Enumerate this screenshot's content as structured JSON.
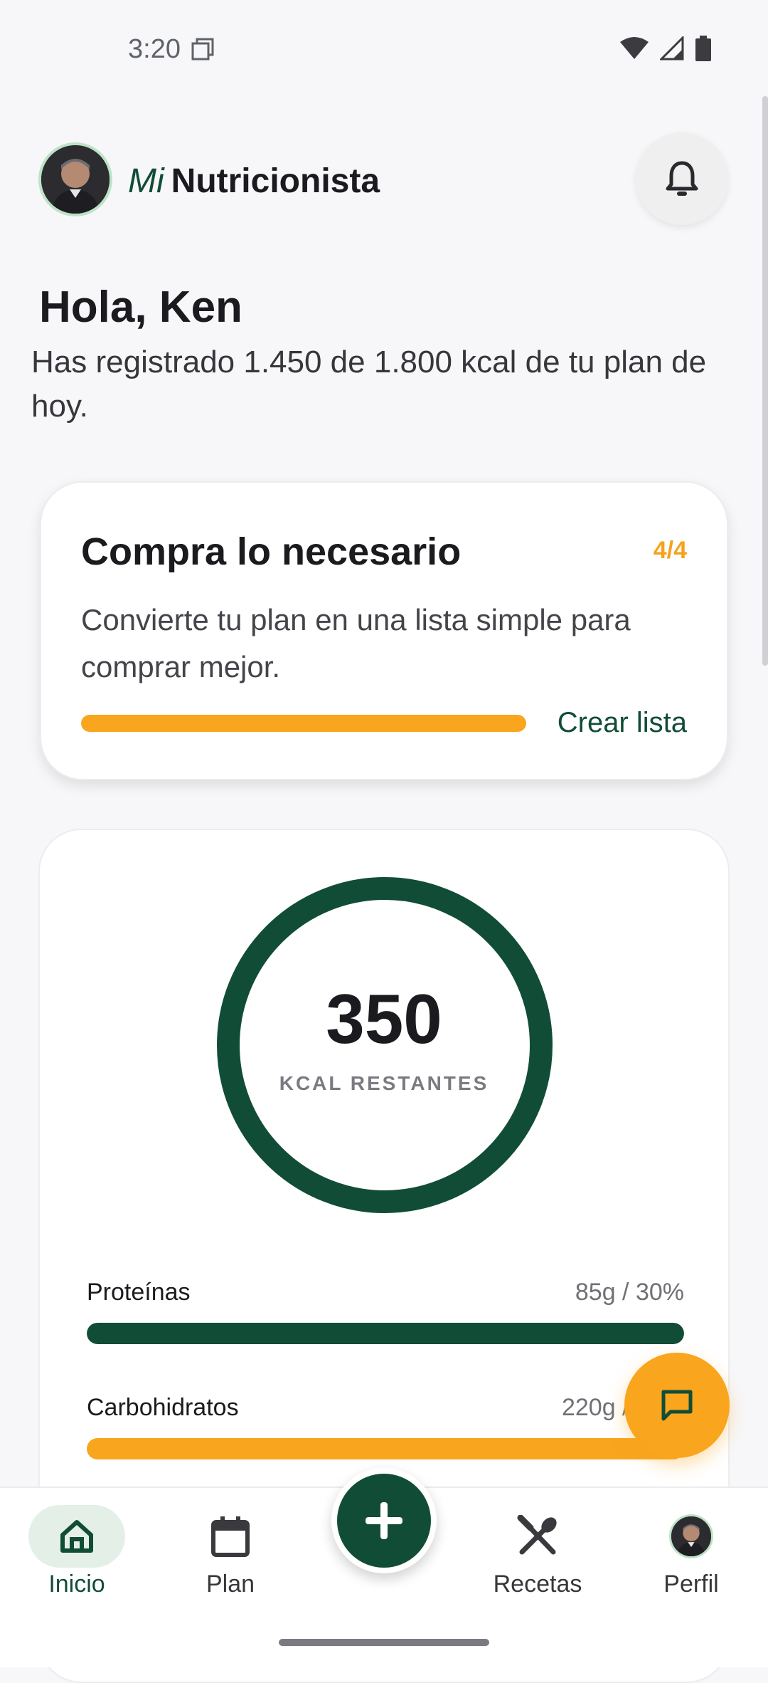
{
  "status_bar": {
    "time": "3:20"
  },
  "header": {
    "brand_prefix": "Mi",
    "brand_name": "Nutricionista"
  },
  "greeting": {
    "title": "Hola, Ken",
    "summary": "Has registrado 1.450 de 1.800 kcal de tu plan de hoy."
  },
  "shopping_card": {
    "title": "Compra lo necesario",
    "step": "4/4",
    "description": "Convierte tu plan en una lista simple para comprar mejor.",
    "progress_fraction": 1.0,
    "link_label": "Crear lista"
  },
  "calories_card": {
    "value": "350",
    "label": "KCAL RESTANTES",
    "macros": [
      {
        "name": "Proteínas",
        "value": "85g / 30%",
        "fill_fraction": 1.0,
        "color": "#114d36"
      },
      {
        "name": "Carbohidratos",
        "value": "220g / 50%",
        "fill_fraction": 1.0,
        "color": "#f9a51d"
      }
    ]
  },
  "bottom_nav": {
    "items": [
      {
        "label": "Inicio",
        "icon": "home-icon",
        "active": true
      },
      {
        "label": "Plan",
        "icon": "calendar-icon",
        "active": false
      },
      {
        "label": "Recetas",
        "icon": "utensils-icon",
        "active": false
      },
      {
        "label": "Perfil",
        "icon": "avatar",
        "active": false
      }
    ]
  },
  "colors": {
    "primary": "#114d36",
    "accent": "#f9a51d",
    "background": "#f7f7f9"
  }
}
